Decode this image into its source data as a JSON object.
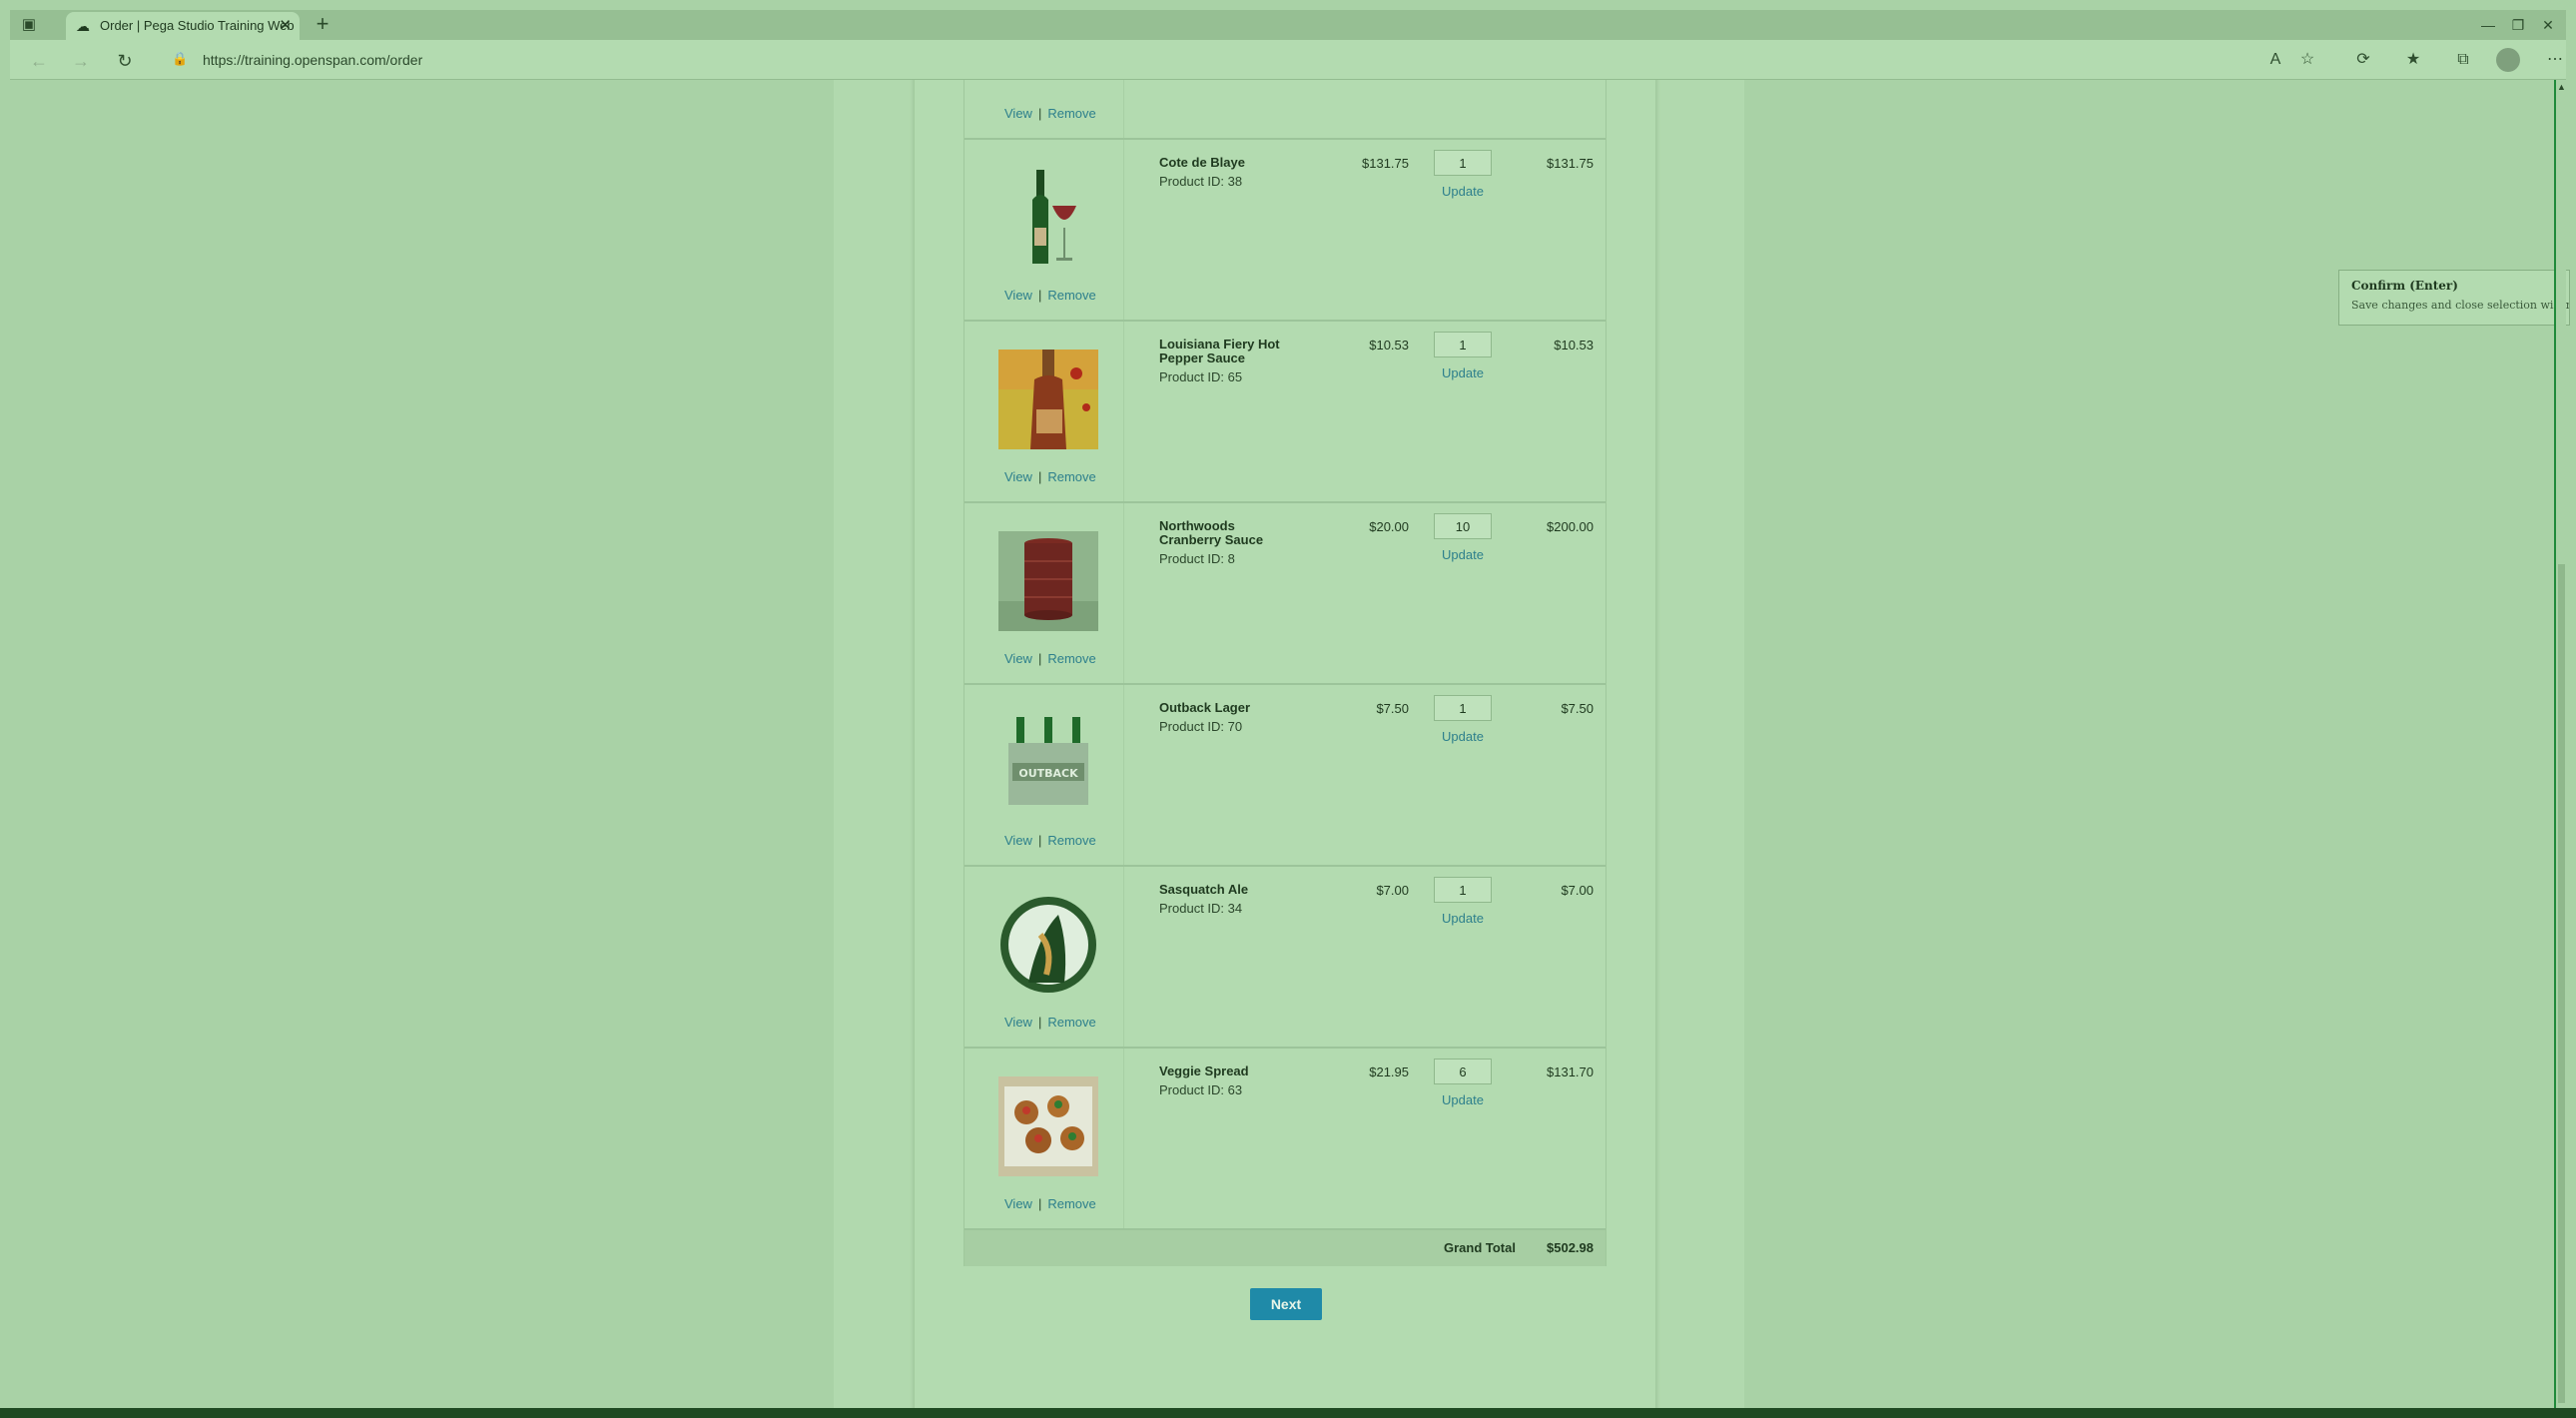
{
  "browser": {
    "tab_title": "Order | Pega Studio Training Web",
    "url": "https://training.openspan.com/order",
    "new_tab": "+",
    "tab_close": "✕"
  },
  "order": {
    "partial_row": {
      "view": "View",
      "remove": "Remove"
    },
    "items": [
      {
        "name": "Cote de Blaye",
        "product_id": "Product ID: 38",
        "price": "$131.75",
        "qty": "1",
        "total": "$131.75",
        "view": "View",
        "remove": "Remove",
        "update": "Update",
        "image": "wine-bottle"
      },
      {
        "name": "Louisiana Fiery Hot Pepper Sauce",
        "product_id": "Product ID: 65",
        "price": "$10.53",
        "qty": "1",
        "total": "$10.53",
        "view": "View",
        "remove": "Remove",
        "update": "Update",
        "image": "hot-sauce"
      },
      {
        "name": "Northwoods Cranberry Sauce",
        "product_id": "Product ID: 8",
        "price": "$20.00",
        "qty": "10",
        "total": "$200.00",
        "view": "View",
        "remove": "Remove",
        "update": "Update",
        "image": "cranberry-sauce"
      },
      {
        "name": "Outback Lager",
        "product_id": "Product ID: 70",
        "price": "$7.50",
        "qty": "1",
        "total": "$7.50",
        "view": "View",
        "remove": "Remove",
        "update": "Update",
        "image": "lager-bottles"
      },
      {
        "name": "Sasquatch Ale",
        "product_id": "Product ID: 34",
        "price": "$7.00",
        "qty": "1",
        "total": "$7.00",
        "view": "View",
        "remove": "Remove",
        "update": "Update",
        "image": "ale-label"
      },
      {
        "name": "Veggie Spread",
        "product_id": "Product ID: 63",
        "price": "$21.95",
        "qty": "6",
        "total": "$131.70",
        "view": "View",
        "remove": "Remove",
        "update": "Update",
        "image": "veggie-appetizer"
      }
    ],
    "grand_total_label": "Grand Total",
    "grand_total_value": "$502.98",
    "next_label": "Next"
  },
  "tooltip": {
    "title": "Confirm (Enter)",
    "description": "Save changes and close selection wizard."
  },
  "colors": {
    "accent": "#1f8aa8",
    "link": "#2d7f8c",
    "overlay_green": "#a9d2a6"
  }
}
